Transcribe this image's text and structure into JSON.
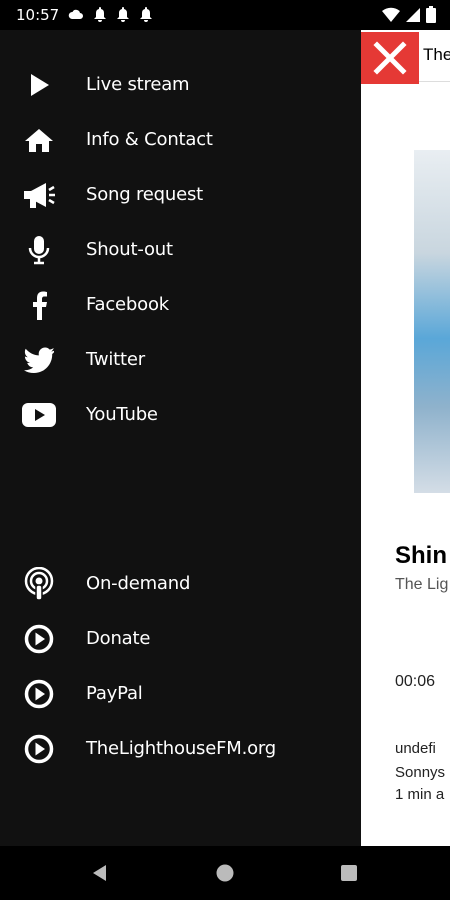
{
  "status_bar": {
    "time": "10:57",
    "notification_icons": [
      "cloud-icon",
      "bell-icon",
      "bell-icon",
      "bell-icon"
    ],
    "right_icons": [
      "wifi-icon",
      "signal-icon",
      "battery-icon"
    ]
  },
  "drawer": {
    "top_items": [
      {
        "label": "Live stream",
        "icon": "play-icon"
      },
      {
        "label": "Info & Contact",
        "icon": "home-icon"
      },
      {
        "label": "Song request",
        "icon": "megaphone-icon"
      },
      {
        "label": "Shout-out",
        "icon": "microphone-icon"
      },
      {
        "label": "Facebook",
        "icon": "facebook-icon"
      },
      {
        "label": "Twitter",
        "icon": "twitter-icon"
      },
      {
        "label": "YouTube",
        "icon": "youtube-icon"
      }
    ],
    "bottom_items": [
      {
        "label": "On-demand",
        "icon": "podcast-icon"
      },
      {
        "label": "Donate",
        "icon": "play-circle-icon"
      },
      {
        "label": "PayPal",
        "icon": "play-circle-icon"
      },
      {
        "label": "TheLighthouseFM.org",
        "icon": "play-circle-icon"
      }
    ]
  },
  "app": {
    "header_title": "The",
    "track_title": "Shin",
    "track_subtitle": "The Lig",
    "time": "00:06",
    "recent": [
      "undefi",
      "Sonnys",
      "1 min a"
    ]
  },
  "colors": {
    "drawer_bg": "#111111",
    "close_button": "#e53935"
  }
}
